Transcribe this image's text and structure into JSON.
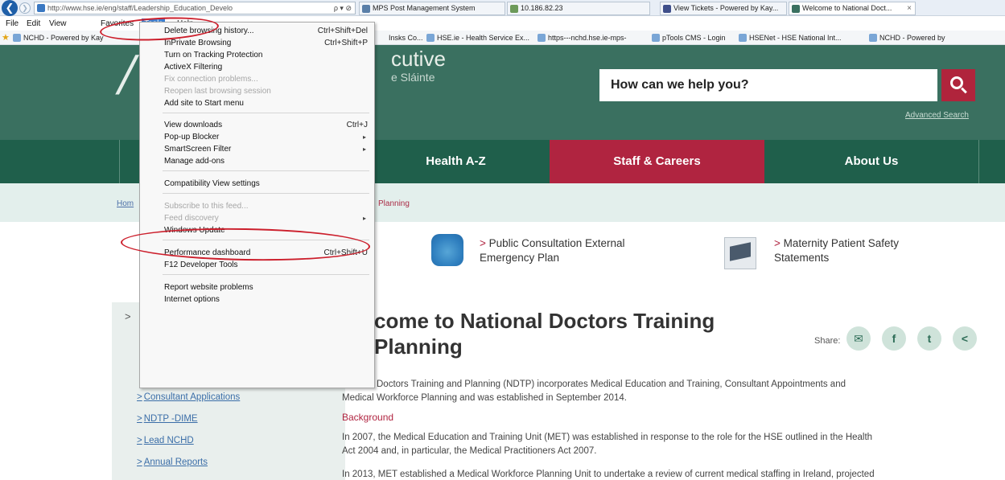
{
  "browser": {
    "url": "http://www.hse.ie/eng/staff/Leadership_Education_Develo",
    "url_tools": "ρ ▾ ⊘",
    "tabs": [
      {
        "label": "MPS Post Management System",
        "color": "#5a7fa8"
      },
      {
        "label": "10.186.82.23",
        "color": "#6c9a5a"
      },
      {
        "label": "View Tickets - Powered by Kay...",
        "color": "#3f4f8a"
      },
      {
        "label": "Welcome to National Doct...",
        "color": "#3a7060"
      }
    ],
    "tab_close": "×",
    "menu": [
      "File",
      "Edit",
      "View",
      "Favorites",
      "Tools",
      "Help"
    ],
    "favorites": [
      "NCHD - Powered by Kay",
      "Insks Co...",
      "HSE.ie - Health Service Ex...",
      "https---nchd.hse.ie-mps-",
      "pTools CMS - Login",
      "HSENet - HSE National Int...",
      "NCHD - Powered by"
    ]
  },
  "tools_menu": [
    {
      "label": "Delete browsing history...",
      "shortcut": "Ctrl+Shift+Del",
      "enabled": true
    },
    {
      "label": "InPrivate Browsing",
      "shortcut": "Ctrl+Shift+P",
      "enabled": true
    },
    {
      "label": "Turn on Tracking Protection",
      "shortcut": "",
      "enabled": true
    },
    {
      "label": "ActiveX Filtering",
      "shortcut": "",
      "enabled": true
    },
    {
      "label": "Fix connection problems...",
      "shortcut": "",
      "enabled": false
    },
    {
      "label": "Reopen last browsing session",
      "shortcut": "",
      "enabled": false
    },
    {
      "label": "Add site to Start menu",
      "shortcut": "",
      "enabled": true
    },
    {
      "label": "View downloads",
      "shortcut": "Ctrl+J",
      "enabled": true
    },
    {
      "label": "Pop-up Blocker",
      "shortcut": "",
      "enabled": true,
      "submenu": true
    },
    {
      "label": "SmartScreen Filter",
      "shortcut": "",
      "enabled": true,
      "submenu": true
    },
    {
      "label": "Manage add-ons",
      "shortcut": "",
      "enabled": true
    },
    {
      "label": "Compatibility View settings",
      "shortcut": "",
      "enabled": true
    },
    {
      "label": "Subscribe to this feed...",
      "shortcut": "",
      "enabled": false
    },
    {
      "label": "Feed discovery",
      "shortcut": "",
      "enabled": false,
      "submenu": true
    },
    {
      "label": "Windows Update",
      "shortcut": "",
      "enabled": true
    },
    {
      "label": "Performance dashboard",
      "shortcut": "Ctrl+Shift+U",
      "enabled": true
    },
    {
      "label": "F12 Developer Tools",
      "shortcut": "",
      "enabled": true
    },
    {
      "label": "Report website problems",
      "shortcut": "",
      "enabled": true
    },
    {
      "label": "Internet options",
      "shortcut": "",
      "enabled": true
    }
  ],
  "header": {
    "logo_glyph": "/",
    "logo_text": "cutive",
    "logo_sub": "e Sláinte",
    "search_prompt": "How can we help you?",
    "advanced_search": "Advanced Search"
  },
  "nav": [
    {
      "label": "Health A-Z",
      "active": false
    },
    {
      "label": "Staff & Careers",
      "active": true
    },
    {
      "label": "About Us",
      "active": false
    }
  ],
  "breadcrumb": {
    "home": "Hom",
    "current": "Planning"
  },
  "promos": [
    {
      "chevron": ">",
      "line1": "Public Consultation External",
      "line2": "Emergency Plan"
    },
    {
      "chevron": ">",
      "line1": "Maternity Patient Safety",
      "line2": "Statements"
    }
  ],
  "sidebar": {
    "chevron": ">",
    "links": [
      "Consultant Applications",
      "NDTP -DIME",
      "Lead NCHD",
      "Annual Reports"
    ],
    "link_prefix": ">"
  },
  "main": {
    "title_line1": "come to National Doctors Training",
    "title_line2": "Planning",
    "share_label": "Share:",
    "share_icons": [
      "✉",
      "f",
      "t",
      "<"
    ],
    "intro_line1": "Doctors Training and Planning (NDTP) incorporates Medical Education and Training, Consultant Appointments and",
    "intro_line2": "Medical Workforce Planning and was established in September 2014.",
    "background_heading": "Background",
    "bg_line1": "In 2007, the Medical Education and Training Unit (MET) was established in response to the role for the HSE outlined in the Health",
    "bg_line2": "Act 2004 and, in particular, the Medical Practitioners Act 2007.",
    "bg_line3": "In 2013, MET established a Medical Workforce Planning Unit to undertake a review of current medical staffing in Ireland, projected"
  }
}
